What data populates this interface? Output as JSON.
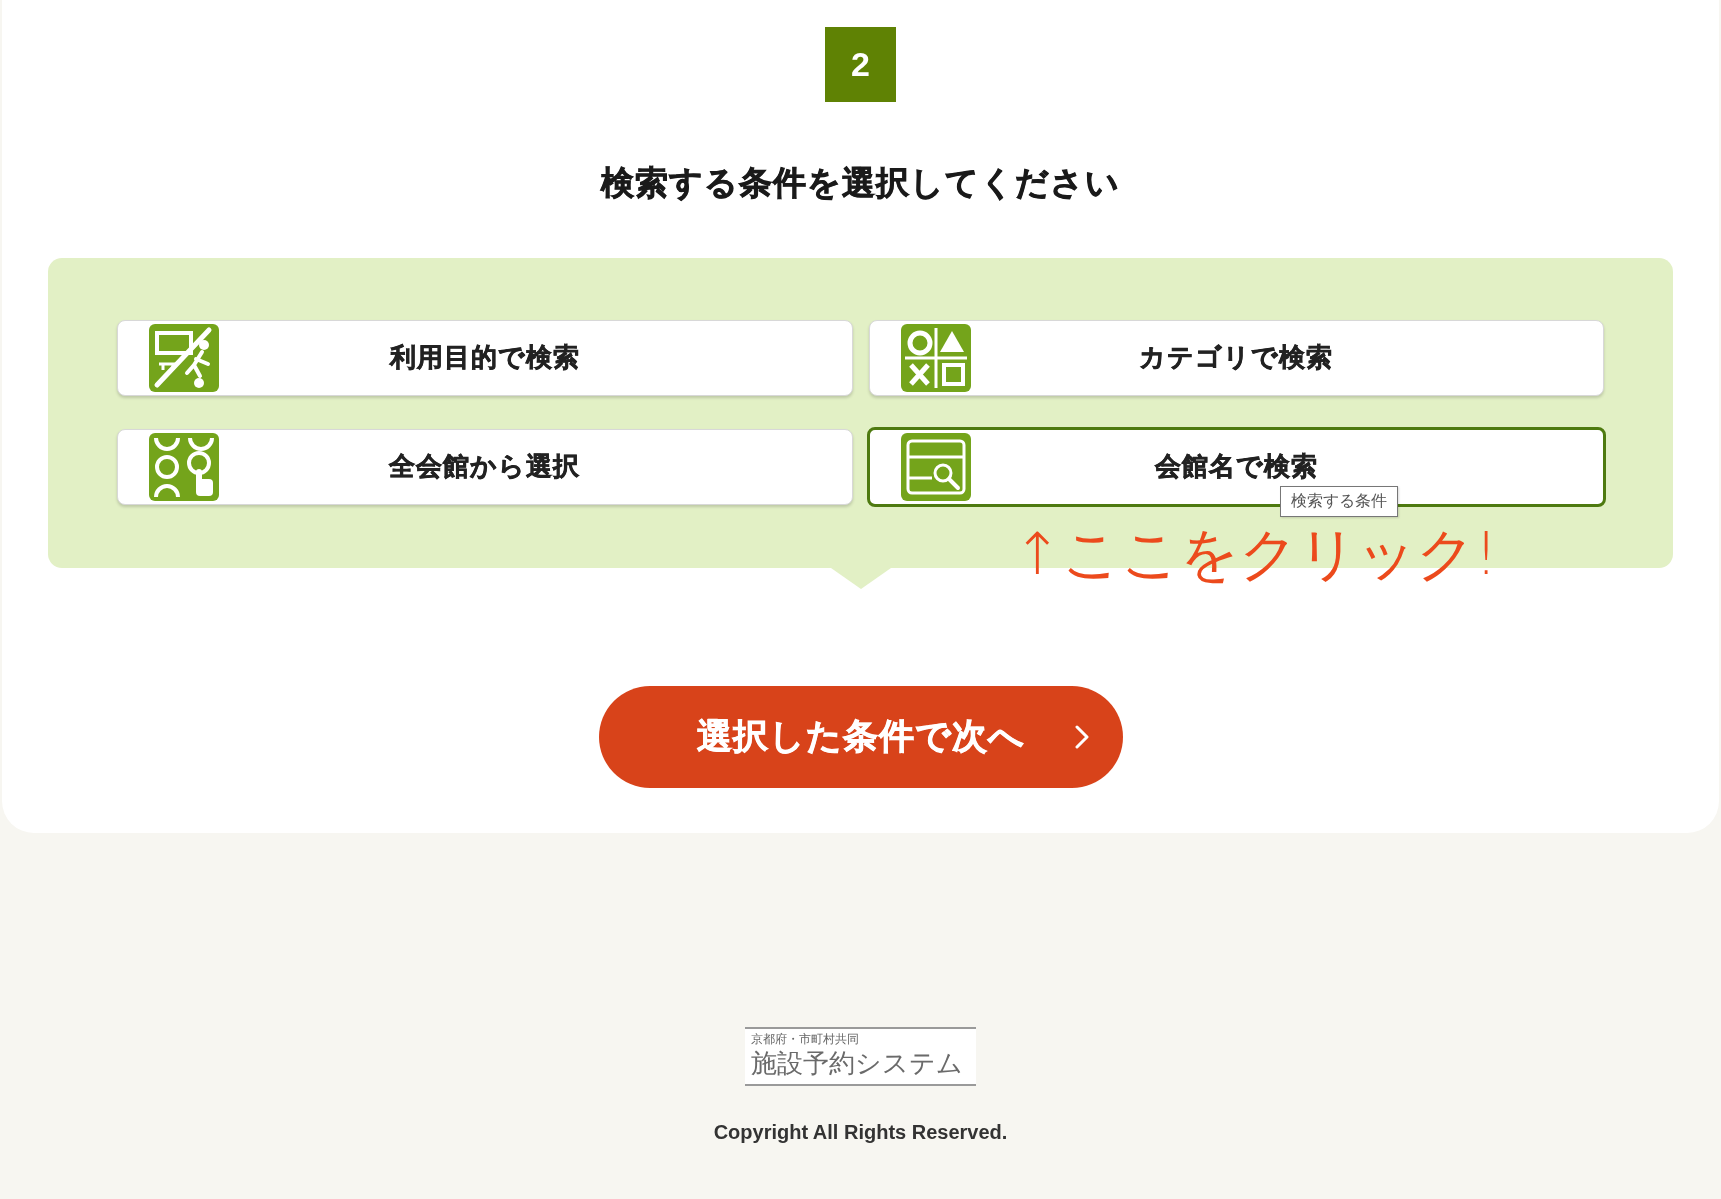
{
  "step": {
    "number": "2"
  },
  "heading": "検索する条件を選択してください",
  "options": [
    {
      "label": "利用目的で検索",
      "kind": "purpose",
      "selected": false
    },
    {
      "label": "カテゴリで検索",
      "kind": "category",
      "selected": false
    },
    {
      "label": "全会館から選択",
      "kind": "all_halls",
      "selected": false
    },
    {
      "label": "会館名で検索",
      "kind": "hall_name",
      "selected": true,
      "tooltip": "検索する条件"
    }
  ],
  "annotation": "↑ここをクリック!",
  "next_button": {
    "label": "選択した条件で次へ"
  },
  "footer": {
    "logo": {
      "subtitle": "京都府・市町村共同",
      "title": "施設予約システム"
    },
    "copyright": "Copyright All Rights Reserved."
  }
}
